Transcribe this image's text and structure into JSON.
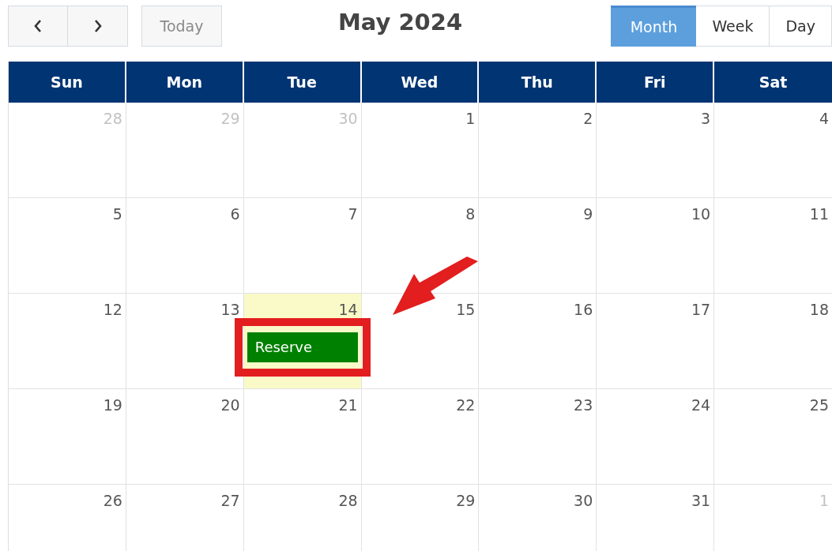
{
  "toolbar": {
    "title": "May 2024",
    "today_button": {
      "label": "Today",
      "disabled": true
    },
    "views": [
      {
        "label": "Month",
        "selected": true
      },
      {
        "label": "Week",
        "selected": false
      },
      {
        "label": "Day",
        "selected": false
      }
    ]
  },
  "calendar": {
    "weekdays": [
      "Sun",
      "Mon",
      "Tue",
      "Wed",
      "Thu",
      "Fri",
      "Sat"
    ],
    "weeks": [
      [
        {
          "day": "28",
          "other_month": true,
          "today": false
        },
        {
          "day": "29",
          "other_month": true,
          "today": false
        },
        {
          "day": "30",
          "other_month": true,
          "today": false
        },
        {
          "day": "1",
          "other_month": false,
          "today": false
        },
        {
          "day": "2",
          "other_month": false,
          "today": false
        },
        {
          "day": "3",
          "other_month": false,
          "today": false
        },
        {
          "day": "4",
          "other_month": false,
          "today": false
        }
      ],
      [
        {
          "day": "5",
          "other_month": false,
          "today": false
        },
        {
          "day": "6",
          "other_month": false,
          "today": false
        },
        {
          "day": "7",
          "other_month": false,
          "today": false
        },
        {
          "day": "8",
          "other_month": false,
          "today": false
        },
        {
          "day": "9",
          "other_month": false,
          "today": false
        },
        {
          "day": "10",
          "other_month": false,
          "today": false
        },
        {
          "day": "11",
          "other_month": false,
          "today": false
        }
      ],
      [
        {
          "day": "12",
          "other_month": false,
          "today": false
        },
        {
          "day": "13",
          "other_month": false,
          "today": false
        },
        {
          "day": "14",
          "other_month": false,
          "today": true,
          "events": [
            {
              "title": "Reserve",
              "color": "#008000",
              "highlighted": true
            }
          ]
        },
        {
          "day": "15",
          "other_month": false,
          "today": false
        },
        {
          "day": "16",
          "other_month": false,
          "today": false
        },
        {
          "day": "17",
          "other_month": false,
          "today": false
        },
        {
          "day": "18",
          "other_month": false,
          "today": false
        }
      ],
      [
        {
          "day": "19",
          "other_month": false,
          "today": false
        },
        {
          "day": "20",
          "other_month": false,
          "today": false
        },
        {
          "day": "21",
          "other_month": false,
          "today": false
        },
        {
          "day": "22",
          "other_month": false,
          "today": false
        },
        {
          "day": "23",
          "other_month": false,
          "today": false
        },
        {
          "day": "24",
          "other_month": false,
          "today": false
        },
        {
          "day": "25",
          "other_month": false,
          "today": false
        }
      ],
      [
        {
          "day": "26",
          "other_month": false,
          "today": false
        },
        {
          "day": "27",
          "other_month": false,
          "today": false
        },
        {
          "day": "28",
          "other_month": false,
          "today": false
        },
        {
          "day": "29",
          "other_month": false,
          "today": false
        },
        {
          "day": "30",
          "other_month": false,
          "today": false
        },
        {
          "day": "31",
          "other_month": false,
          "today": false
        },
        {
          "day": "1",
          "other_month": true,
          "today": false
        }
      ]
    ]
  }
}
